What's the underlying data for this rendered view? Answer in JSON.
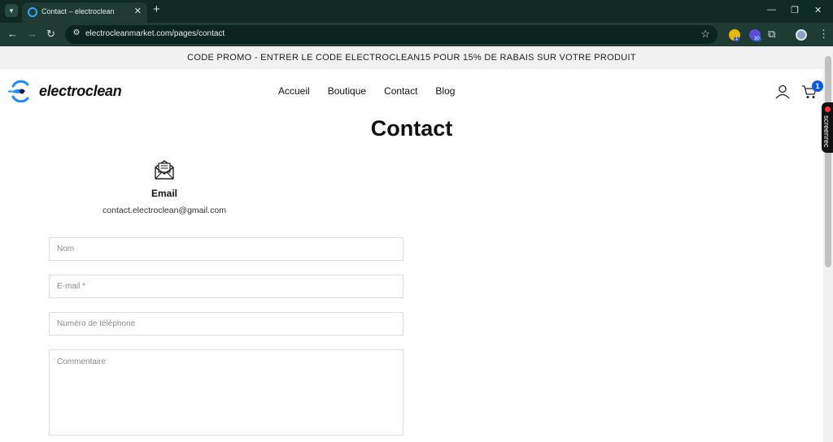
{
  "browser": {
    "tab_title": "Contact – electroclean",
    "url": "electrocleanmarket.com/pages/contact",
    "extension_badges": [
      "1",
      "30"
    ]
  },
  "promo_banner": "CODE PROMO - ENTRER LE CODE ELECTROCLEAN15 POUR 15% DE RABAIS SUR VOTRE PRODUIT",
  "header": {
    "brand": "electroclean",
    "nav": [
      "Accueil",
      "Boutique",
      "Contact",
      "Blog"
    ],
    "cart_count": "1"
  },
  "screenrec_label": "screenrec",
  "page": {
    "title": "Contact",
    "email_label": "Email",
    "email_value": "contact.electroclean@gmail.com"
  },
  "form": {
    "name_placeholder": "Nom",
    "email_placeholder": "E-mail *",
    "phone_placeholder": "Numéro de téléphone",
    "comment_placeholder": "Commentaire"
  },
  "colors": {
    "brand_blue": "#1a8cff",
    "cart_badge": "#0a5adf",
    "chrome_dark": "#0f2a23"
  }
}
